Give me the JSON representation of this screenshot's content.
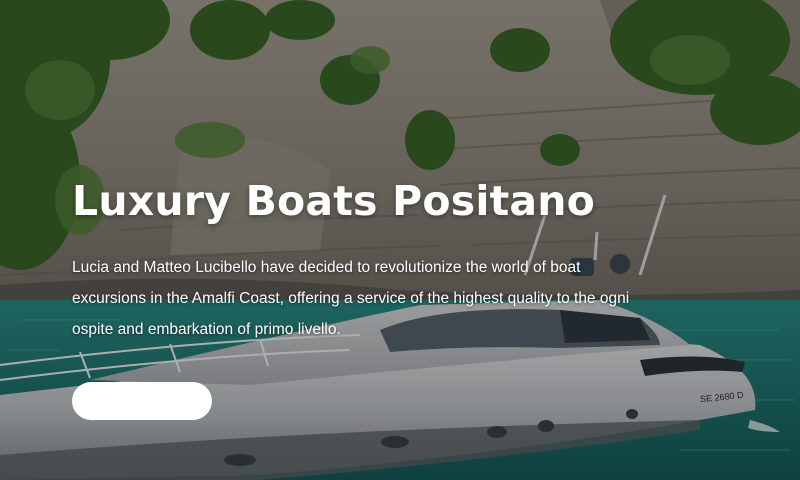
{
  "hero": {
    "title": "Luxury Boats Positano",
    "description": "Lucia and Matteo Lucibello have decided to revolutionize the world of boat excursions in the Amalfi Coast, offering a service of the highest quality to the ogni ospite and embarkation of primo livello.",
    "button_label": "",
    "boat_registration": "SE 2680 D"
  },
  "colors": {
    "sea": "#1f7d7a",
    "cliff": "#8f8a80",
    "vegetation": "#3f6b2e",
    "hull": "#c9ccce",
    "button": "#ffffff",
    "text": "#ffffff"
  }
}
